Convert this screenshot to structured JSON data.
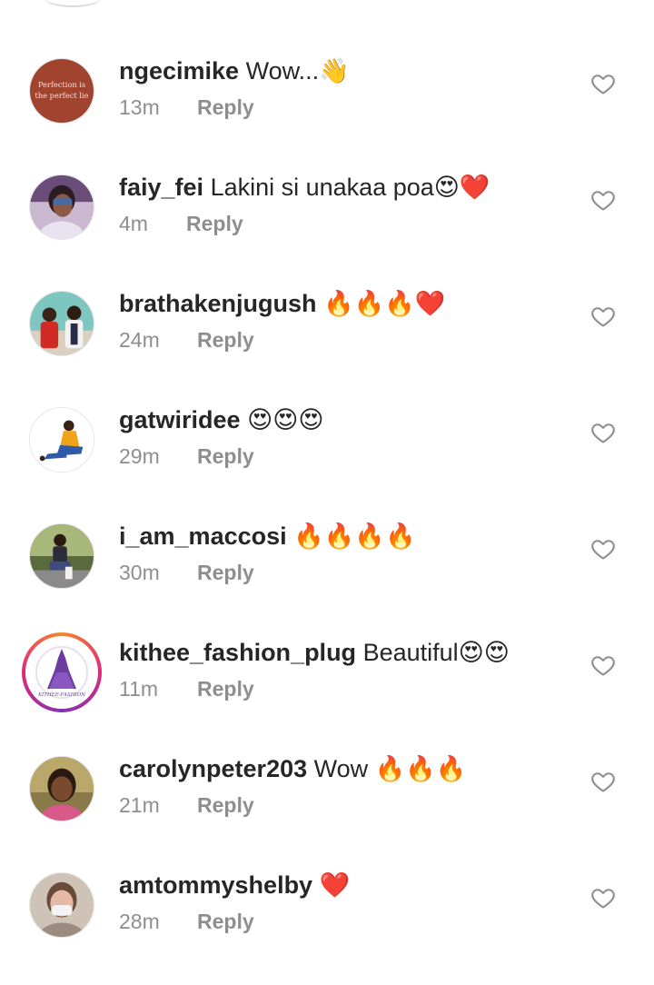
{
  "comments": [
    {
      "username": "ngecimike",
      "text": "Wow...👋",
      "time": "13m",
      "reply": "Reply",
      "avatar_text_1": "Perfection is",
      "avatar_text_2": "the perfect lie"
    },
    {
      "username": "faiy_fei",
      "text": "Lakini si unakaa poa😍❤️",
      "time": "4m",
      "reply": "Reply"
    },
    {
      "username": "brathakenjugush",
      "text": "🔥🔥🔥❤️",
      "time": "24m",
      "reply": "Reply"
    },
    {
      "username": "gatwiridee",
      "text": "😍😍😍",
      "time": "29m",
      "reply": "Reply"
    },
    {
      "username": "i_am_maccosi",
      "text": "🔥🔥🔥🔥",
      "time": "30m",
      "reply": "Reply"
    },
    {
      "username": "kithee_fashion_plug",
      "text": "Beautiful😍😍",
      "time": "11m",
      "reply": "Reply",
      "avatar_text_1": "KITHEE-FASHION"
    },
    {
      "username": "carolynpeter203",
      "text": "Wow 🔥🔥🔥",
      "time": "21m",
      "reply": "Reply"
    },
    {
      "username": "amtommyshelby",
      "text": "❤️",
      "time": "28m",
      "reply": "Reply"
    }
  ]
}
